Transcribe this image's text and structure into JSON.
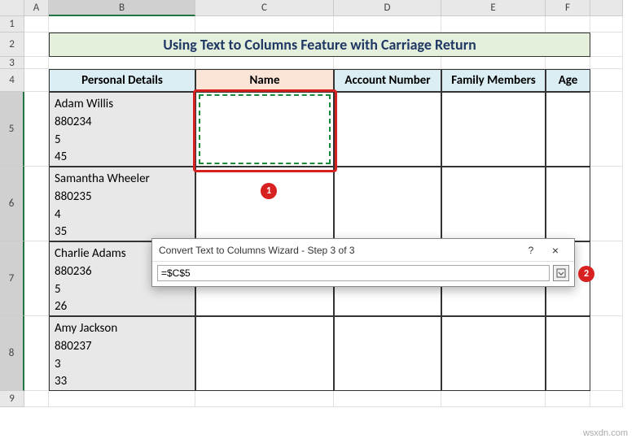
{
  "columns": [
    "A",
    "B",
    "C",
    "D",
    "E",
    "F"
  ],
  "rows": [
    "1",
    "2",
    "3",
    "4",
    "5",
    "6",
    "7",
    "8",
    "9"
  ],
  "title": "Using Text to Columns Feature with Carriage Return",
  "headers": {
    "b": "Personal Details",
    "c": "Name",
    "d": "Account Number",
    "e": "Family Members",
    "f": "Age"
  },
  "data": {
    "b5": "Adam Willis\n880234\n5\n45",
    "b6": "Samantha Wheeler\n880235\n4\n35",
    "b7": "Charlie Adams\n880236\n5\n26",
    "b8": "Amy Jackson\n880237\n3\n33"
  },
  "dialog": {
    "title": "Convert Text to Columns Wizard - Step 3 of 3",
    "destination": "=$C$5",
    "help": "?",
    "close": "×"
  },
  "callouts": {
    "one": "1",
    "two": "2"
  },
  "watermark": "wsxdn.com",
  "chart_data": {
    "type": "table",
    "title": "Using Text to Columns Feature with Carriage Return",
    "columns": [
      "Personal Details",
      "Name",
      "Account Number",
      "Family Members",
      "Age"
    ],
    "rows": [
      {
        "Personal Details": "Adam Willis\n880234\n5\n45",
        "Name": "",
        "Account Number": "",
        "Family Members": "",
        "Age": ""
      },
      {
        "Personal Details": "Samantha Wheeler\n880235\n4\n35",
        "Name": "",
        "Account Number": "",
        "Family Members": "",
        "Age": ""
      },
      {
        "Personal Details": "Charlie Adams\n880236\n5\n26",
        "Name": "",
        "Account Number": "",
        "Family Members": "",
        "Age": ""
      },
      {
        "Personal Details": "Amy Jackson\n880237\n3\n33",
        "Name": "",
        "Account Number": "",
        "Family Members": "",
        "Age": ""
      }
    ]
  }
}
